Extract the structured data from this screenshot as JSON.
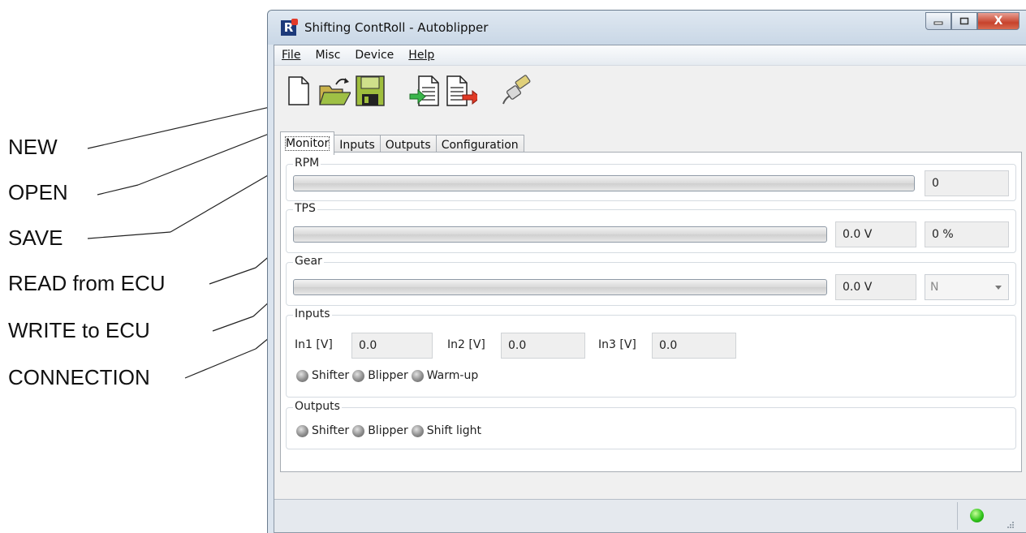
{
  "callouts": {
    "new": "NEW",
    "open": "OPEN",
    "save": "SAVE",
    "read": "READ from ECU",
    "write": "WRITE to ECU",
    "connection": "CONNECTION"
  },
  "window": {
    "title": "Shifting ContRoll - Autoblipper",
    "close_glyph": "X"
  },
  "menu": {
    "file": "File",
    "misc": "Misc",
    "device": "Device",
    "help": "Help"
  },
  "tabs": [
    "Monitor",
    "Inputs",
    "Outputs",
    "Configuration"
  ],
  "monitor": {
    "rpm": {
      "label": "RPM",
      "value": "0",
      "level": 0
    },
    "tps": {
      "label": "TPS",
      "voltage": "0.0 V",
      "percent": "0 %",
      "level": 0
    },
    "gear": {
      "label": "Gear",
      "voltage": "0.0 V",
      "selected": "N",
      "level": 0
    },
    "inputs": {
      "label": "Inputs",
      "in1_label": "In1 [V]",
      "in1_value": "0.0",
      "in2_label": "In2 [V]",
      "in2_value": "0.0",
      "in3_label": "In3 [V]",
      "in3_value": "0.0",
      "indicators": [
        "Shifter",
        "Blipper",
        "Warm-up"
      ]
    },
    "outputs": {
      "label": "Outputs",
      "indicators": [
        "Shifter",
        "Blipper",
        "Shift light"
      ]
    }
  },
  "icons": {
    "new": "new-file-icon",
    "open": "open-folder-icon",
    "save": "save-disk-icon",
    "read": "read-from-ecu-icon",
    "write": "write-to-ecu-icon",
    "connection": "connection-cable-icon"
  },
  "colors": {
    "status_connected": "#32c51d",
    "led_off": "#8d8d8d",
    "close_button": "#c7422c"
  }
}
